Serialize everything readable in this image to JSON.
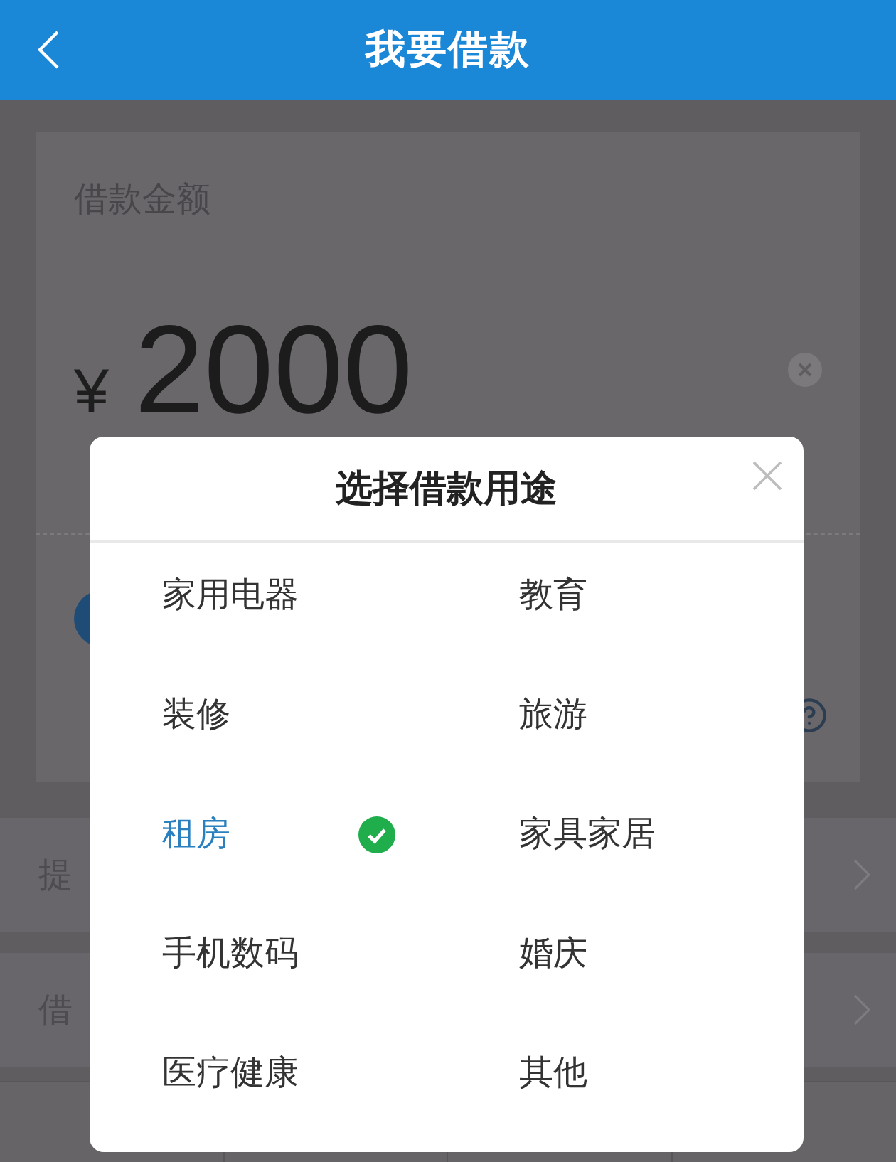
{
  "header": {
    "title": "我要借款"
  },
  "amount_card": {
    "label": "借款金额",
    "currency": "¥",
    "amount": "2000"
  },
  "menu_rows": [
    {
      "label": "提"
    },
    {
      "label": "借"
    }
  ],
  "purpose_dialog": {
    "title": "选择借款用途",
    "options": [
      {
        "label": "家用电器",
        "selected": false
      },
      {
        "label": "教育",
        "selected": false
      },
      {
        "label": "装修",
        "selected": false
      },
      {
        "label": "旅游",
        "selected": false
      },
      {
        "label": "租房",
        "selected": true
      },
      {
        "label": "家具家居",
        "selected": false
      },
      {
        "label": "手机数码",
        "selected": false
      },
      {
        "label": "婚庆",
        "selected": false
      },
      {
        "label": "医疗健康",
        "selected": false
      },
      {
        "label": "其他",
        "selected": false
      }
    ]
  }
}
